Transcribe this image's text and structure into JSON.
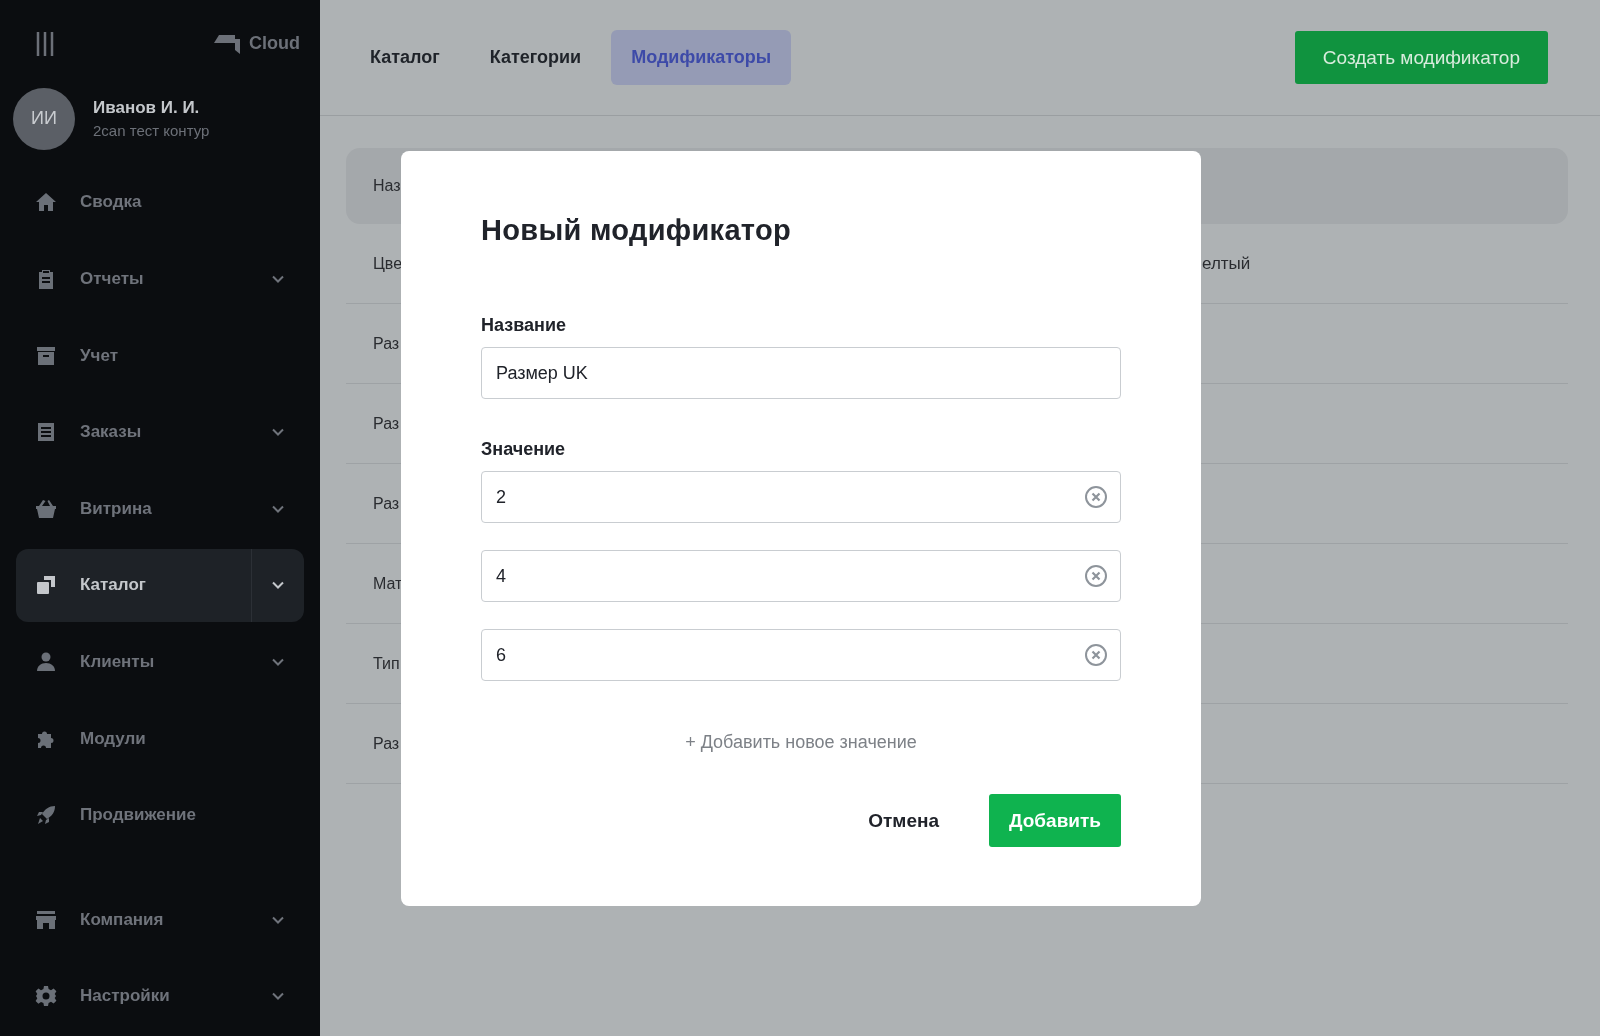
{
  "sidebar": {
    "brand": "Cloud",
    "user": {
      "initials": "ИИ",
      "name": "Иванов И. И.",
      "org": "2can тест контур"
    },
    "items": [
      {
        "kind": "home",
        "label": "Сводка",
        "expandable": false,
        "selected": false
      },
      {
        "kind": "clipboard",
        "label": "Отчеты",
        "expandable": true,
        "selected": false
      },
      {
        "kind": "archive",
        "label": "Учет",
        "expandable": false,
        "selected": false
      },
      {
        "kind": "list",
        "label": "Заказы",
        "expandable": true,
        "selected": false
      },
      {
        "kind": "basket",
        "label": "Витрина",
        "expandable": true,
        "selected": false
      },
      {
        "kind": "copy",
        "label": "Каталог",
        "expandable": true,
        "selected": true
      },
      {
        "kind": "person",
        "label": "Клиенты",
        "expandable": true,
        "selected": false
      },
      {
        "kind": "puzzle",
        "label": "Модули",
        "expandable": false,
        "selected": false
      },
      {
        "kind": "rocket",
        "label": "Продвижение",
        "expandable": false,
        "selected": false
      }
    ],
    "bottom_items": [
      {
        "kind": "store",
        "label": "Компания",
        "expandable": true,
        "selected": false
      },
      {
        "kind": "gear",
        "label": "Настройки",
        "expandable": true,
        "selected": false
      }
    ]
  },
  "tabs": [
    {
      "label": "Каталог",
      "selected": false
    },
    {
      "label": "Категории",
      "selected": false
    },
    {
      "label": "Модификаторы",
      "selected": true
    }
  ],
  "create_button": "Создать модификатор",
  "table": {
    "header": "Наз",
    "rows": [
      {
        "column_1": "Цве",
        "column_2": "елтый"
      },
      {
        "column_1": "Раз"
      },
      {
        "column_1": "Раз"
      },
      {
        "column_1": "Раз"
      },
      {
        "column_1": "Мат"
      },
      {
        "column_1": "Тип"
      },
      {
        "column_1": "Раз"
      }
    ]
  },
  "dialog": {
    "title": "Новый модификатор",
    "name_label": "Название",
    "name_value": "Размер UK",
    "values_label": "Значение",
    "values": [
      "2",
      "4",
      "6"
    ],
    "add_value": "+ Добавить новое значение",
    "cancel": "Отмена",
    "submit": "Добавить"
  }
}
